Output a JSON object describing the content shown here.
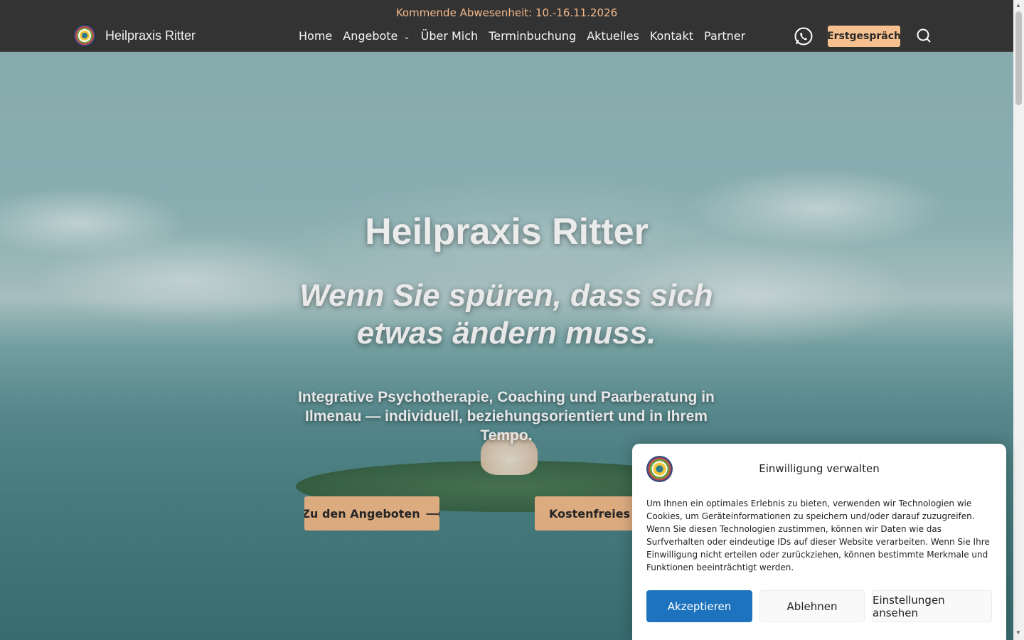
{
  "header": {
    "notice": "Kommende Abwesenheit: 10.-16.11.2026",
    "brand_name": "Heilpraxis Ritter",
    "nav": [
      "Home",
      "Angebote",
      "Über Mich",
      "Terminbuchung",
      "Aktuelles",
      "Kontakt",
      "Partner"
    ],
    "cta_label": "Erstgespräch",
    "icons": {
      "whatsapp": "whatsapp-icon",
      "search": "search-icon",
      "dropdown": "chevron-down-icon"
    }
  },
  "hero": {
    "title": "Heilpraxis Ritter",
    "subtitle": "Wenn Sie spüren, dass sich etwas ändern muss.",
    "text": "Integrative Psychotherapie, Coaching und Paarberatung in Ilmenau — individuell, beziehungsorientiert und in Ihrem Tempo.",
    "button_offers": "Zu den Angeboten",
    "button_free": "Kostenfreies Erstgespräch"
  },
  "consent": {
    "title": "Einwilligung verwalten",
    "text": "Um Ihnen ein optimales Erlebnis zu bieten, verwenden wir Technologien wie Cookies, um Geräteinformationen zu speichern und/oder darauf zuzugreifen. Wenn Sie diesen Technologien zustimmen, können wir Daten wie das Surfverhalten oder eindeutige IDs auf dieser Website verarbeiten. Wenn Sie Ihre Einwilligung nicht erteilen oder zurückziehen, können bestimmte Merkmale und Funktionen beeinträchtigt werden.",
    "accept": "Akzeptieren",
    "deny": "Ablehnen",
    "settings": "Einstellungen ansehen"
  },
  "colors": {
    "topbar": "#333333",
    "notice_text": "#f4b98a",
    "cta": "#f6c08f",
    "accept_button": "#1e73be"
  }
}
